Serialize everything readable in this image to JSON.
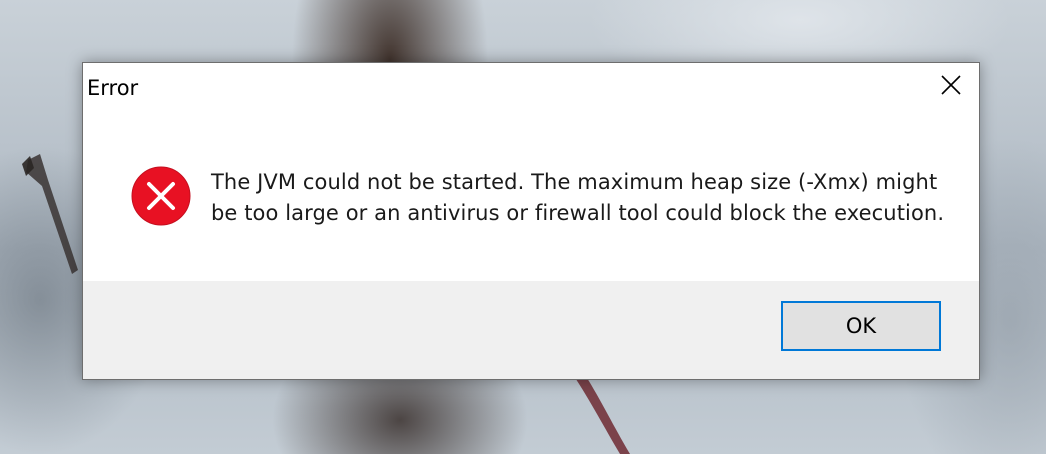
{
  "dialog": {
    "title": "Error",
    "close_icon": "close-icon",
    "icon": "error-icon",
    "message_lines": [
      "The JVM could not be started. The maximum heap size (-Xmx) might",
      "be too large or an antivirus or firewall tool could block the execution."
    ],
    "ok_label": "OK"
  },
  "colors": {
    "error_red": "#e81123",
    "button_focus_border": "#0078d7",
    "button_bar_bg": "#f0f0f0"
  }
}
